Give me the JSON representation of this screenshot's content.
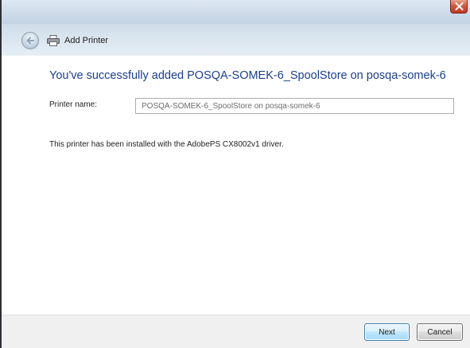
{
  "window": {
    "title": "Add Printer",
    "close_icon": "close-icon",
    "back_icon": "back-arrow-icon",
    "printer_icon": "printer-icon"
  },
  "main": {
    "heading": "You've successfully added POSQA-SOMEK-6_SpoolStore on posqa-somek-6",
    "printer_name_label": "Printer name:",
    "printer_name_value": "POSQA-SOMEK-6_SpoolStore on posqa-somek-6",
    "driver_info": "This printer has been installed with the AdobePS CX8002v1 driver."
  },
  "footer": {
    "next_label": "Next",
    "cancel_label": "Cancel"
  },
  "colors": {
    "heading": "#1a3f8c",
    "close_button": "#c13a20",
    "next_button_border": "#3c7fb1"
  }
}
